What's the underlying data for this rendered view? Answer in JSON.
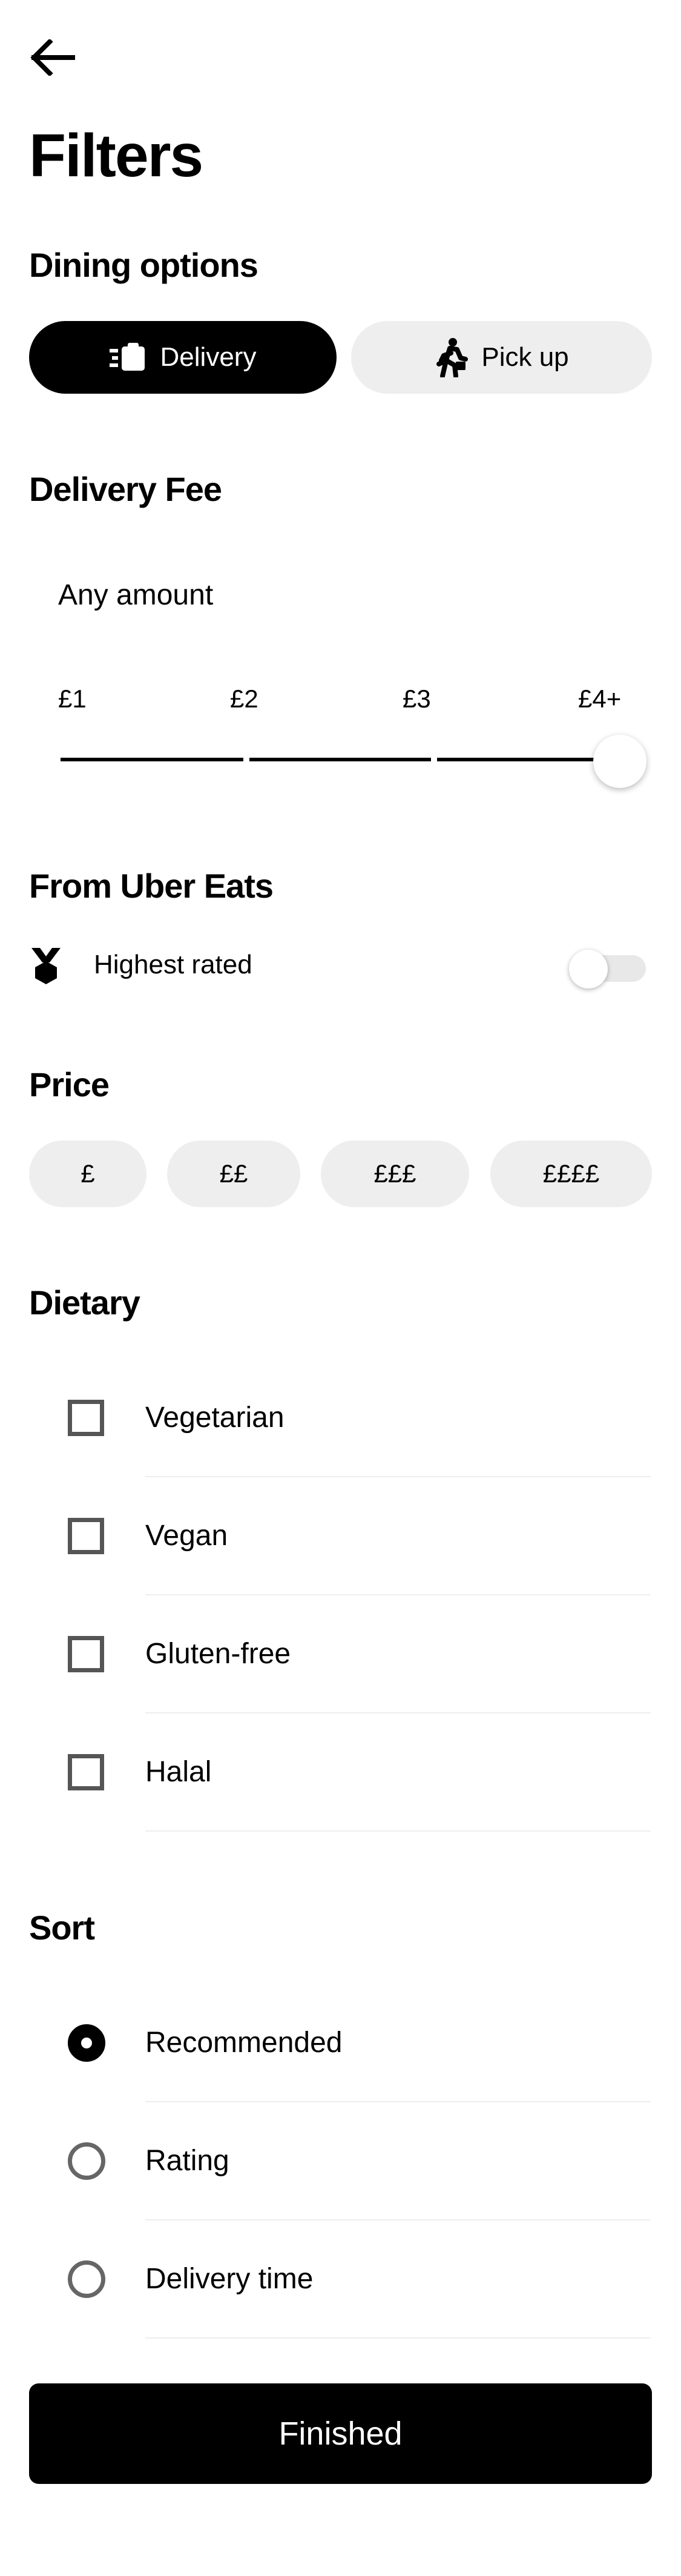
{
  "header": {
    "back_icon": "arrow-left-icon",
    "title": "Filters"
  },
  "dining": {
    "heading": "Dining options",
    "options": [
      {
        "label": "Delivery",
        "icon": "delivery-icon",
        "selected": true
      },
      {
        "label": "Pick up",
        "icon": "walking-person-icon",
        "selected": false
      }
    ]
  },
  "delivery_fee": {
    "heading": "Delivery Fee",
    "value_label": "Any amount",
    "ticks": [
      "£1",
      "£2",
      "£3",
      "£4+"
    ],
    "selected_index": 3
  },
  "uber": {
    "heading": "From Uber Eats",
    "item_label": "Highest rated",
    "item_icon": "medal-icon",
    "toggle_on": false
  },
  "price": {
    "heading": "Price",
    "options": [
      "£",
      "££",
      "£££",
      "££££"
    ]
  },
  "dietary": {
    "heading": "Dietary",
    "items": [
      {
        "label": "Vegetarian",
        "checked": false
      },
      {
        "label": "Vegan",
        "checked": false
      },
      {
        "label": "Gluten-free",
        "checked": false
      },
      {
        "label": "Halal",
        "checked": false
      }
    ]
  },
  "sort": {
    "heading": "Sort",
    "items": [
      {
        "label": "Recommended",
        "selected": true
      },
      {
        "label": "Rating",
        "selected": false
      },
      {
        "label": "Delivery time",
        "selected": false
      }
    ]
  },
  "footer": {
    "finished_label": "Finished"
  },
  "colors": {
    "primary": "#000000",
    "pill_bg": "#eeeeee",
    "divider": "#eeeeee"
  }
}
